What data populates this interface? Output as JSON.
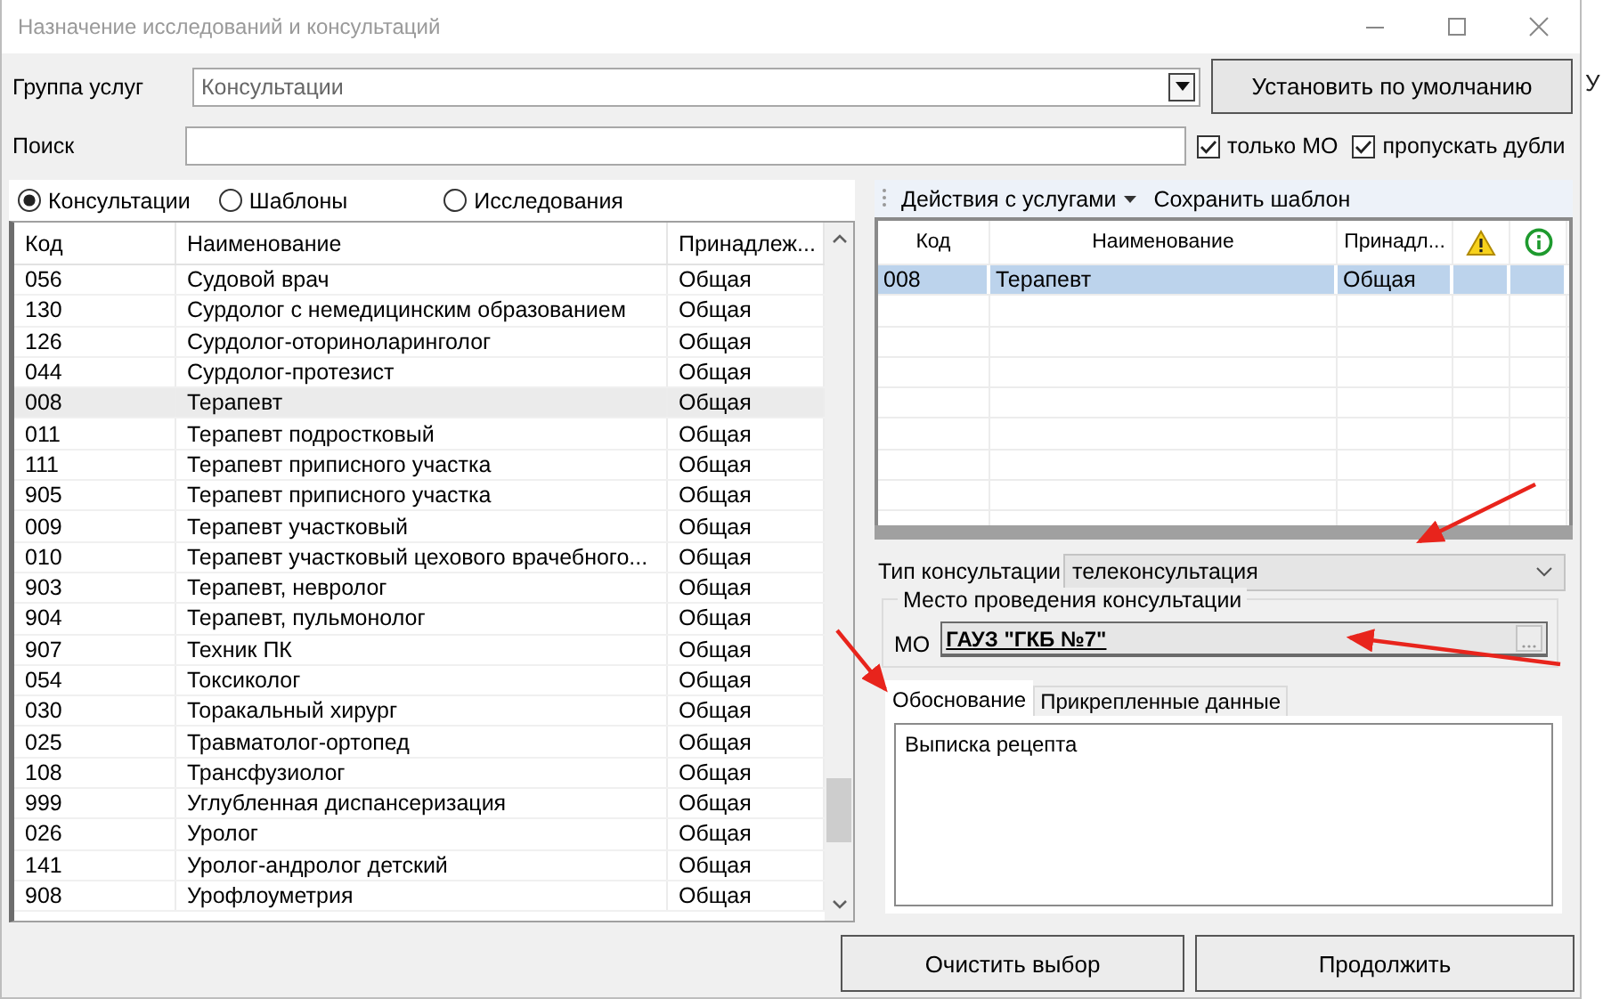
{
  "window": {
    "title": "Назначение исследований и консультаций"
  },
  "group": {
    "label": "Группа услуг",
    "value": "Консультации"
  },
  "default_button": "Установить по умолчанию",
  "search": {
    "label": "Поиск"
  },
  "filters": [
    {
      "label": "только МО",
      "checked": true
    },
    {
      "label": "пропускать дубли",
      "checked": true
    }
  ],
  "modes": [
    {
      "label": "Консультации",
      "selected": true
    },
    {
      "label": "Шаблоны",
      "selected": false
    },
    {
      "label": "Исследования",
      "selected": false
    }
  ],
  "services_table": {
    "columns": [
      "Код",
      "Наименование",
      "Принадлеж..."
    ],
    "rows": [
      {
        "cells": [
          "056",
          "Судовой врач",
          "Общая"
        ],
        "selected": false
      },
      {
        "cells": [
          "130",
          "Сурдолог с немедицинским образованием",
          "Общая"
        ],
        "selected": false
      },
      {
        "cells": [
          "126",
          "Сурдолог-оториноларинголог",
          "Общая"
        ],
        "selected": false
      },
      {
        "cells": [
          "044",
          "Сурдолог-протезист",
          "Общая"
        ],
        "selected": false
      },
      {
        "cells": [
          "008",
          "Терапевт",
          "Общая"
        ],
        "selected": true
      },
      {
        "cells": [
          "011",
          "Терапевт подростковый",
          "Общая"
        ],
        "selected": false
      },
      {
        "cells": [
          "111",
          "Терапевт приписного участка",
          "Общая"
        ],
        "selected": false
      },
      {
        "cells": [
          "905",
          "Терапевт приписного участка",
          "Общая"
        ],
        "selected": false
      },
      {
        "cells": [
          "009",
          "Терапевт участковый",
          "Общая"
        ],
        "selected": false
      },
      {
        "cells": [
          "010",
          "Терапевт участковый цехового врачебного...",
          "Общая"
        ],
        "selected": false
      },
      {
        "cells": [
          "903",
          "Терапевт, невролог",
          "Общая"
        ],
        "selected": false
      },
      {
        "cells": [
          "904",
          "Терапевт, пульмонолог",
          "Общая"
        ],
        "selected": false
      },
      {
        "cells": [
          "907",
          "Техник ПК",
          "Общая"
        ],
        "selected": false
      },
      {
        "cells": [
          "054",
          "Токсиколог",
          "Общая"
        ],
        "selected": false
      },
      {
        "cells": [
          "030",
          "Торакальный хирург",
          "Общая"
        ],
        "selected": false
      },
      {
        "cells": [
          "025",
          "Травматолог-ортопед",
          "Общая"
        ],
        "selected": false
      },
      {
        "cells": [
          "108",
          "Трансфузиолог",
          "Общая"
        ],
        "selected": false
      },
      {
        "cells": [
          "999",
          "Углубленная диспансеризация",
          "Общая"
        ],
        "selected": false
      },
      {
        "cells": [
          "026",
          "Уролог",
          "Общая"
        ],
        "selected": false
      },
      {
        "cells": [
          "141",
          "Уролог-андролог детский",
          "Общая"
        ],
        "selected": false
      },
      {
        "cells": [
          "908",
          "Урофлоуметрия",
          "Общая"
        ],
        "selected": false
      }
    ]
  },
  "actions_toolbar": [
    {
      "label": "Действия с услугами",
      "kind": "menu"
    },
    {
      "label": "Сохранить шаблон",
      "kind": "button"
    }
  ],
  "selected_table": {
    "columns": [
      {
        "kind": "text",
        "label": "Код"
      },
      {
        "kind": "text",
        "label": "Наименование"
      },
      {
        "kind": "text",
        "label": "Принадл..."
      },
      {
        "kind": "warning"
      },
      {
        "kind": "info"
      }
    ],
    "rows": [
      {
        "cells": [
          "008",
          "Терапевт",
          "Общая"
        ],
        "selected": true
      }
    ]
  },
  "consultation_type": {
    "label": "Тип консультации",
    "value": "телеконсультация"
  },
  "venue": {
    "title": "Место проведения консультации",
    "label": "МО",
    "value": "ГАУЗ \"ГКБ №7\""
  },
  "tabs": [
    {
      "label": "Обоснование",
      "selected": true
    },
    {
      "label": "Прикрепленные данные",
      "selected": false
    }
  ],
  "justification": "Выписка рецепта",
  "buttons": [
    "Очистить выбор",
    "Продолжить"
  ],
  "background_text": "У"
}
